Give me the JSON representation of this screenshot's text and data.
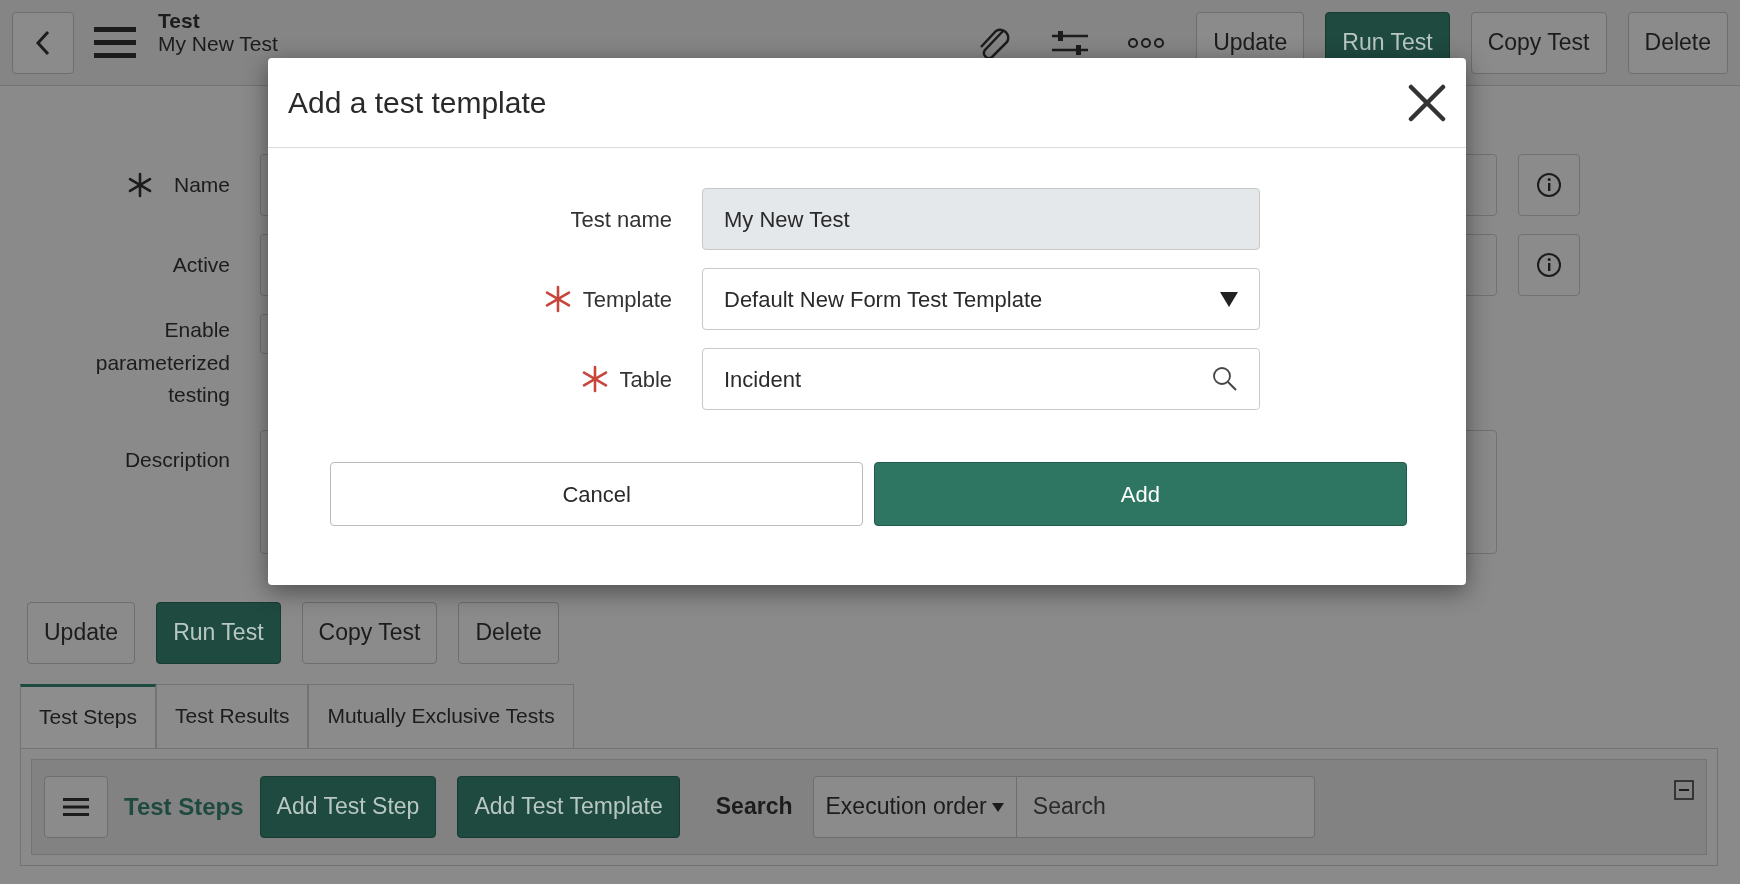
{
  "header": {
    "title": "Test",
    "subtitle": "My New Test",
    "buttons": [
      {
        "label": "Update",
        "kind": "default"
      },
      {
        "label": "Run Test",
        "kind": "primary"
      },
      {
        "label": "Copy Test",
        "kind": "default"
      },
      {
        "label": "Delete",
        "kind": "default"
      }
    ]
  },
  "form": {
    "fields": [
      {
        "label": "Name",
        "required": true,
        "kind": "text",
        "info": true
      },
      {
        "label": "Active",
        "required": false,
        "kind": "text",
        "info": true
      },
      {
        "label": "Enable parameterized testing",
        "required": false,
        "kind": "checkbox",
        "info": false
      },
      {
        "label": "Description",
        "required": false,
        "kind": "textarea",
        "info": false
      }
    ]
  },
  "form_buttons": [
    {
      "label": "Update",
      "kind": "default"
    },
    {
      "label": "Run Test",
      "kind": "primary"
    },
    {
      "label": "Copy Test",
      "kind": "default"
    },
    {
      "label": "Delete",
      "kind": "default"
    }
  ],
  "tabs": [
    {
      "label": "Test Steps",
      "selected": true
    },
    {
      "label": "Test Results",
      "selected": false
    },
    {
      "label": "Mutually Exclusive Tests",
      "selected": false
    }
  ],
  "list_toolbar": {
    "title": "Test Steps",
    "buttons": [
      {
        "label": "Add Test Step",
        "kind": "primary"
      },
      {
        "label": "Add Test Template",
        "kind": "primary"
      }
    ],
    "search_label": "Search",
    "sort": "Execution order",
    "search_placeholder": "Search"
  },
  "modal": {
    "title": "Add a test template",
    "fields": [
      {
        "label": "Test name",
        "required": false,
        "kind": "readonly",
        "value": "My New Test"
      },
      {
        "label": "Template",
        "required": true,
        "kind": "select",
        "value": "Default New Form Test Template"
      },
      {
        "label": "Table",
        "required": true,
        "kind": "reference",
        "value": "Incident"
      }
    ],
    "buttons": [
      {
        "label": "Cancel",
        "kind": "default"
      },
      {
        "label": "Add",
        "kind": "primary"
      }
    ]
  }
}
